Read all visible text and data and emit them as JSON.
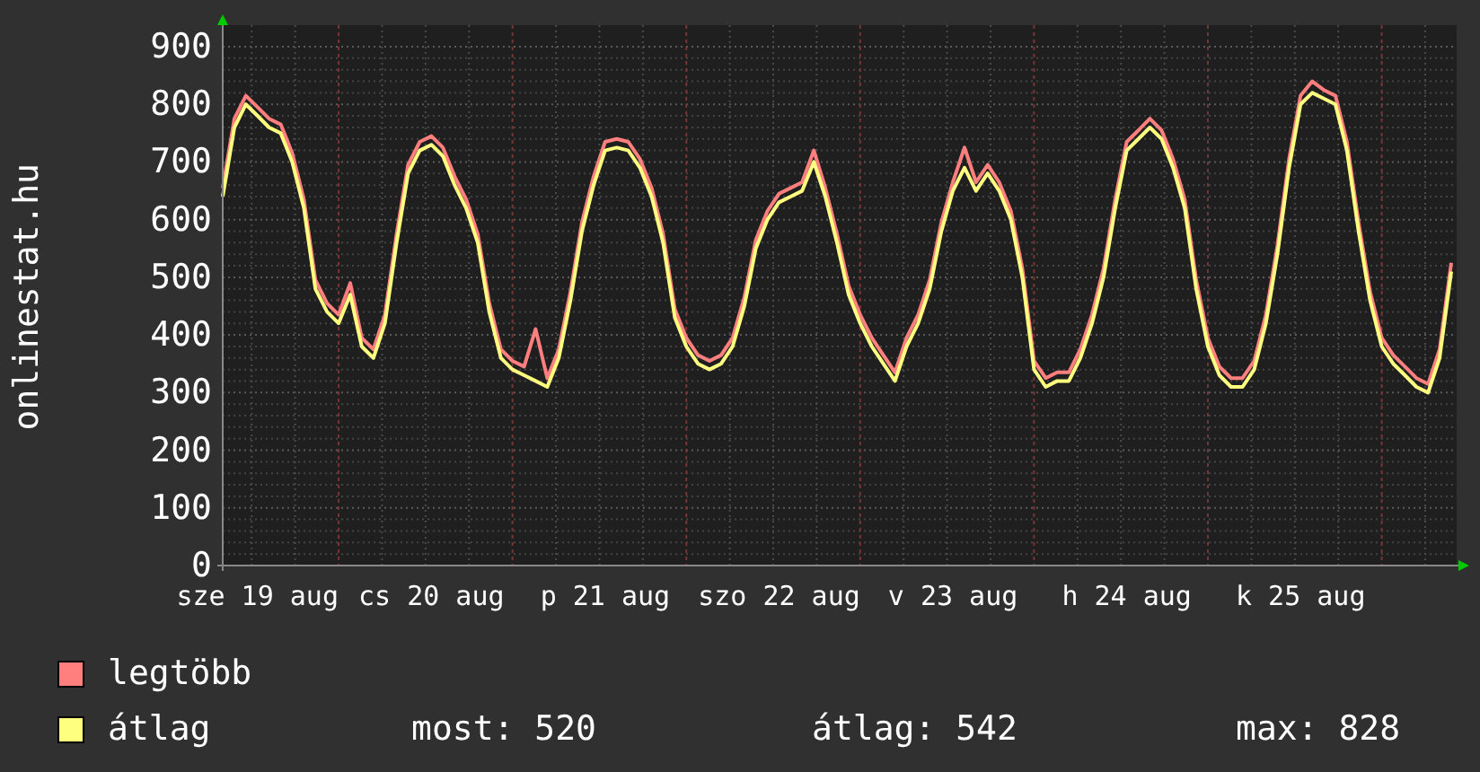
{
  "graph": {
    "chart_data": {
      "type": "line",
      "ylabel": "onlinestat.hu",
      "grid": true,
      "ylim": [
        0,
        900
      ],
      "yticks": [
        0,
        100,
        200,
        300,
        400,
        500,
        600,
        700,
        800,
        900
      ],
      "categories": [
        null,
        null,
        null,
        "sze 19 aug",
        null,
        null,
        null,
        null,
        null,
        null,
        null,
        null,
        null,
        null,
        null,
        null,
        null,
        null,
        "cs 20 aug",
        null,
        null,
        null,
        null,
        null,
        null,
        null,
        null,
        null,
        null,
        null,
        null,
        null,
        null,
        "p 21 aug",
        null,
        null,
        null,
        null,
        null,
        null,
        null,
        null,
        null,
        null,
        null,
        null,
        null,
        null,
        "szo 22 aug",
        null,
        null,
        null,
        null,
        null,
        null,
        null,
        null,
        null,
        null,
        null,
        null,
        null,
        null,
        "v 23 aug",
        null,
        null,
        null,
        null,
        null,
        null,
        null,
        null,
        null,
        null,
        null,
        null,
        null,
        null,
        "h 24 aug",
        null,
        null,
        null,
        null,
        null,
        null,
        null,
        null,
        null,
        null,
        null,
        null,
        null,
        null,
        "k 25 aug",
        null,
        null,
        null,
        null,
        null,
        null,
        null,
        null,
        null,
        null,
        null,
        null,
        null
      ],
      "series": [
        {
          "name": "legtöbb",
          "color": "#ff7f7f",
          "values": [
            655,
            775,
            815,
            795,
            775,
            765,
            715,
            635,
            495,
            455,
            435,
            490,
            395,
            375,
            435,
            575,
            695,
            735,
            745,
            725,
            675,
            635,
            575,
            455,
            375,
            355,
            345,
            410,
            325,
            375,
            475,
            595,
            675,
            735,
            740,
            735,
            705,
            655,
            575,
            445,
            395,
            365,
            355,
            365,
            395,
            465,
            565,
            615,
            645,
            655,
            665,
            720,
            655,
            575,
            485,
            435,
            395,
            365,
            335,
            395,
            435,
            495,
            595,
            665,
            725,
            665,
            695,
            665,
            615,
            515,
            355,
            325,
            335,
            335,
            375,
            435,
            515,
            635,
            735,
            755,
            775,
            755,
            705,
            635,
            495,
            395,
            345,
            325,
            325,
            355,
            435,
            555,
            705,
            815,
            840,
            825,
            815,
            735,
            595,
            475,
            395,
            365,
            345,
            325,
            315,
            375,
            525
          ]
        },
        {
          "name": "átlag",
          "color": "#ffff7f",
          "values": [
            640,
            760,
            800,
            780,
            760,
            750,
            700,
            620,
            480,
            440,
            420,
            470,
            380,
            360,
            420,
            560,
            680,
            720,
            730,
            710,
            660,
            620,
            560,
            440,
            360,
            340,
            330,
            320,
            310,
            360,
            460,
            580,
            660,
            720,
            725,
            720,
            690,
            640,
            560,
            430,
            380,
            350,
            340,
            350,
            380,
            450,
            550,
            600,
            630,
            640,
            650,
            700,
            640,
            560,
            470,
            420,
            380,
            350,
            320,
            380,
            420,
            480,
            580,
            650,
            690,
            650,
            680,
            650,
            600,
            500,
            340,
            310,
            320,
            320,
            360,
            420,
            500,
            620,
            720,
            740,
            760,
            740,
            690,
            620,
            480,
            380,
            330,
            310,
            310,
            340,
            420,
            540,
            690,
            800,
            820,
            810,
            800,
            720,
            580,
            460,
            380,
            350,
            330,
            310,
            300,
            360,
            510
          ]
        }
      ]
    }
  },
  "legend": {
    "stats": [
      "most: 520",
      "átlag: 542",
      "max: 828"
    ]
  }
}
